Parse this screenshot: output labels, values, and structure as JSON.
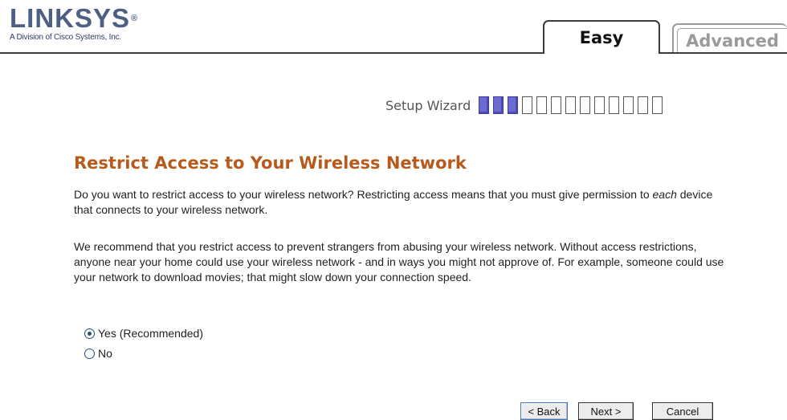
{
  "header": {
    "logo_text": "LINKSYS",
    "logo_registered": "®",
    "logo_subtitle": "A Division of Cisco Systems, Inc."
  },
  "tabs": [
    {
      "label": "Easy",
      "active": true
    },
    {
      "label": "Advanced",
      "active": false
    }
  ],
  "wizard": {
    "label": "Setup Wizard",
    "total_steps": 13,
    "completed_steps": 3
  },
  "content": {
    "title": "Restrict Access to Your Wireless Network",
    "paragraph1_before": "Do you want to restrict access to your wireless network? Restricting access means that you must give permission to ",
    "paragraph1_emph": "each",
    "paragraph1_after": " device that connects to your wireless network.",
    "paragraph2": "We recommend that you restrict access to prevent strangers from abusing your wireless network. Without access restrictions, anyone near your home could use your wireless network - and in ways you might not approve of. For example, someone could use your network to download movies; that might slow down your connection speed."
  },
  "options": [
    {
      "label": "Yes (Recommended)",
      "checked": true
    },
    {
      "label": "No",
      "checked": false
    }
  ],
  "buttons": {
    "back": "< Back",
    "next": "Next >",
    "cancel": "Cancel"
  },
  "colors": {
    "title": "#b85a1c",
    "logo": "#4c5f85",
    "wizard_done": "#6c6cd0"
  }
}
